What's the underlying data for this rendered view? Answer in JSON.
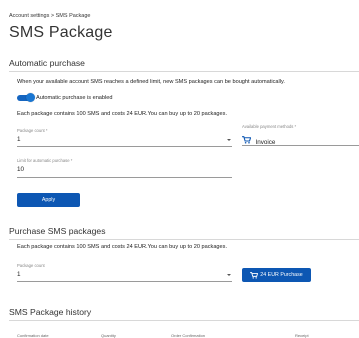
{
  "breadcrumb": "Account settings > SMS Package",
  "page_title": "SMS Package",
  "automatic_purchase": {
    "title": "Automatic purchase",
    "description": "When your available account SMS reaches a defined limit, new SMS packages can be bought automatically.",
    "toggle_label": "Automatic purchase is enabled",
    "toggle_on": true,
    "package_info": "Each package contains 100 SMS and costs 24 EUR.You can buy up to 20 packages.",
    "package_count_label": "Package count *",
    "package_count_value": "1",
    "payment_method_label": "Available payment methods *",
    "payment_method_value": "Invoice",
    "limit_label": "Limit for automatic purchase *",
    "limit_value": "10",
    "apply_button": "Apply"
  },
  "purchase": {
    "title": "Purchase SMS packages",
    "package_info": "Each package contains 100 SMS and costs 24 EUR.You can buy up to 20 packages.",
    "package_count_label": "Package count",
    "package_count_value": "1",
    "purchase_button": "24 EUR Purchase"
  },
  "history": {
    "title": "SMS Package history",
    "columns": [
      "Confirmation date",
      "Quantity",
      "Order Confirmation",
      "Receipt"
    ]
  },
  "colors": {
    "accent": "#0d57b3",
    "toggle": "#1976d2"
  },
  "icons": {
    "payment": "cart-icon",
    "purchase": "cart-icon"
  }
}
